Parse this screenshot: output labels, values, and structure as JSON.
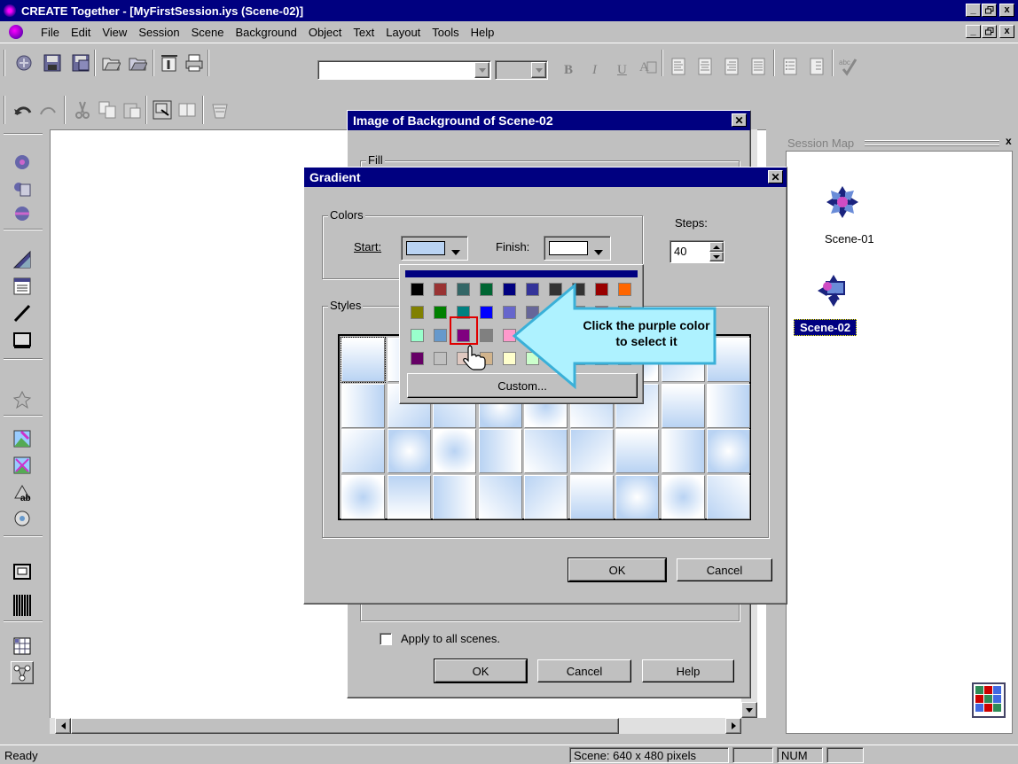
{
  "app": {
    "title": "CREATE Together - [MyFirstSession.iys (Scene-02)]",
    "window_controls": {
      "minimize": "_",
      "restore": "🗗",
      "close": "x"
    }
  },
  "menu": [
    "File",
    "Edit",
    "View",
    "Session",
    "Scene",
    "Background",
    "Object",
    "Text",
    "Layout",
    "Tools",
    "Help"
  ],
  "format_bar": {
    "bold": "B",
    "italic": "I",
    "underline": "U"
  },
  "session_map": {
    "title": "Session Map",
    "scenes": [
      {
        "label": "Scene-01",
        "selected": false
      },
      {
        "label": "Scene-02",
        "selected": true
      }
    ]
  },
  "bg_dialog": {
    "title": "Image of Background of Scene-02",
    "fill_label": "Fill",
    "apply_all": "Apply to all scenes.",
    "ok": "OK",
    "cancel": "Cancel",
    "help": "Help"
  },
  "gradient_dialog": {
    "title": "Gradient",
    "colors_label": "Colors",
    "start_label": "Start:",
    "finish_label": "Finish:",
    "steps_label": "Steps:",
    "steps_value": "40",
    "styles_label": "Styles",
    "ok": "OK",
    "cancel": "Cancel",
    "start_color": "#b9d3f3",
    "finish_color": "#ffffff"
  },
  "palette": {
    "highlight_color": "#800080",
    "custom_label": "Custom...",
    "rows": [
      [
        "#000000",
        "#993333",
        "#336666",
        "#006633",
        "#000080",
        "#333399",
        "#333333",
        "#333333",
        "#990000",
        "#ff6600"
      ],
      [
        "#808000",
        "#008000",
        "#008080",
        "#0000ff",
        "#6666cc",
        "#666699",
        "#808080",
        "#808080",
        "#cc3333",
        "#ff9900"
      ],
      [
        "#99ffcc",
        "#6699cc",
        "#800080",
        "#808080",
        "#ff99cc",
        "#ffcc99",
        "#ffff99",
        "#ccffcc",
        "#ccffff",
        "#99ccff"
      ],
      [
        "#660066",
        "#c0c0c0",
        "#e0c8c0",
        "#d2b48c",
        "#ffffcc",
        "#ccffcc",
        "#ccffff",
        "#99ccff",
        "#cc99ff",
        "#ffffff"
      ]
    ]
  },
  "callout": {
    "text": "Click the purple color to select it"
  },
  "status_bar": {
    "ready": "Ready",
    "scene_size": "Scene: 640 x 480 pixels",
    "num": "NUM"
  }
}
